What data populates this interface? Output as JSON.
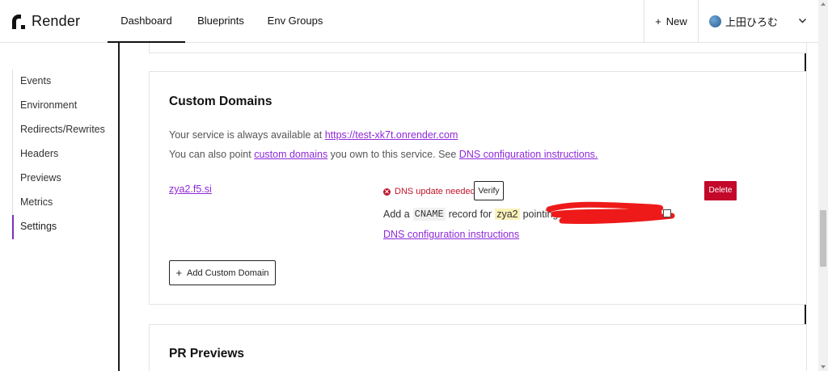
{
  "brand": {
    "name": "Render"
  },
  "nav": {
    "tabs": [
      {
        "label": "Dashboard",
        "active": true
      },
      {
        "label": "Blueprints",
        "active": false
      },
      {
        "label": "Env Groups",
        "active": false
      }
    ],
    "new_label": "New",
    "user_name": "上田ひろむ"
  },
  "sidebar": {
    "items": [
      {
        "label": "Events"
      },
      {
        "label": "Environment"
      },
      {
        "label": "Redirects/Rewrites"
      },
      {
        "label": "Headers"
      },
      {
        "label": "Previews"
      },
      {
        "label": "Metrics"
      },
      {
        "label": "Settings",
        "active": true
      }
    ]
  },
  "custom_domains": {
    "title": "Custom Domains",
    "info_line1_prefix": "Your service is always available at ",
    "service_url": "https://test-xk7t.onrender.com",
    "info_line2_prefix": "You can also point ",
    "custom_domains_link": "custom domains",
    "info_line2_middle": " you own to this service. See ",
    "dns_instructions_link": "DNS configuration instructions.",
    "domain": {
      "name": "zya2.f5.si",
      "status": "DNS update needed",
      "verify_label": "Verify",
      "delete_label": "Delete",
      "cname_prefix": "Add a",
      "cname_code": "CNAME",
      "cname_mid": "record for",
      "cname_host": "zya2",
      "cname_suffix": "pointing t",
      "dns_link": "DNS configuration instructions"
    },
    "add_label": "Add Custom Domain"
  },
  "pr_previews": {
    "title": "PR Previews"
  },
  "colors": {
    "link": "#8f29d9",
    "danger": "#c3082a",
    "accent": "#7b2fbe"
  }
}
